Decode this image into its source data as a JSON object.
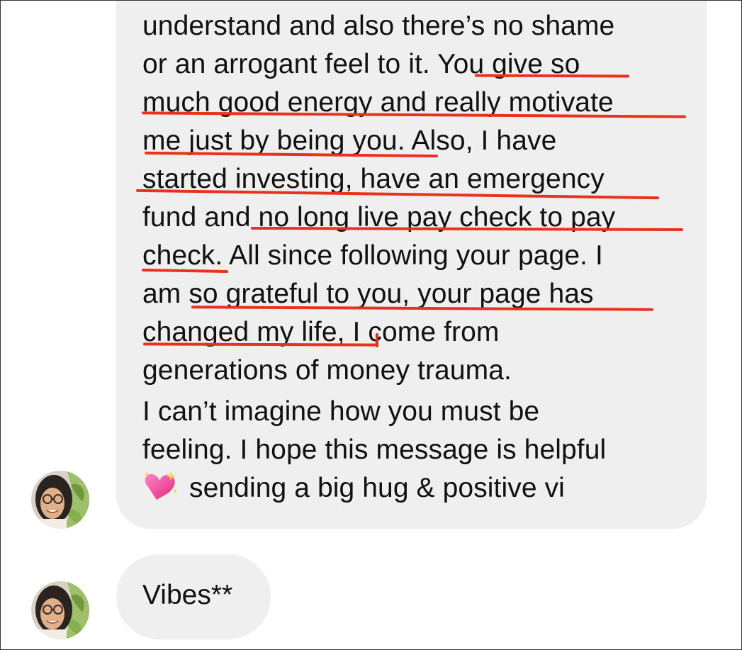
{
  "message_1": {
    "lines": [
      "understand and also there’s no shame",
      "or an arrogant feel to it. You give so",
      "much good energy and really motivate",
      "me just by being you. Also, I have",
      "started investing, have an emergency",
      "fund and no long live pay check to pay",
      "check. All since following your page. I",
      "am so grateful to you, your page has",
      "changed my life, I come from",
      "generations of money trauma.",
      "I can’t imagine how you must be",
      "feeling. I hope this message is helpful"
    ],
    "last_line_emoji": "sparkling-heart-icon",
    "last_line_text": "sending a big hug & positive vi"
  },
  "message_2": {
    "text": "Vibes**"
  },
  "colors": {
    "bubble": "#efefef",
    "underline": "#e8321e",
    "text": "#111111",
    "heart": "#f0479a"
  }
}
